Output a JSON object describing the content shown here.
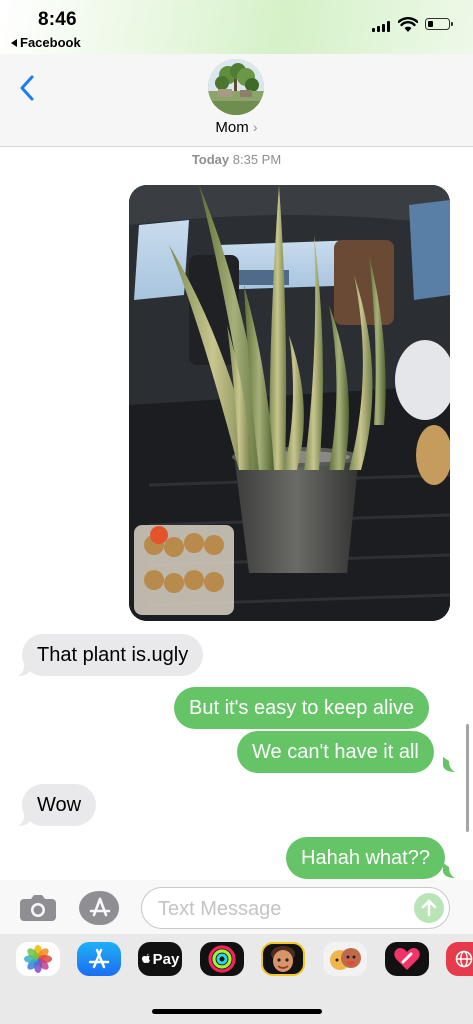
{
  "status_bar": {
    "time": "8:46",
    "back_app": "Facebook"
  },
  "header": {
    "contact_name": "Mom",
    "chevron": "›"
  },
  "conversation": {
    "timestamp_day": "Today",
    "timestamp_time": "8:35 PM",
    "messages": [
      {
        "from": "me",
        "type": "image",
        "description": "photo"
      },
      {
        "from": "them",
        "text": "That plant is.ugly"
      },
      {
        "from": "me",
        "text": "But it's easy to keep alive"
      },
      {
        "from": "me",
        "text": "We can't have it all"
      },
      {
        "from": "them",
        "text": "Wow"
      },
      {
        "from": "me",
        "text": "Hahah what??"
      }
    ]
  },
  "input": {
    "placeholder": "Text Message",
    "value": ""
  },
  "app_drawer": {
    "apple_pay_label": "Pay",
    "apps": [
      "photos-icon",
      "app-store-icon",
      "apple-pay-icon",
      "activity-icon",
      "memoji-icon",
      "animoji-icon",
      "digital-touch-icon",
      "web-icon"
    ]
  },
  "colors": {
    "sms_bubble": "#65c466",
    "incoming_bubble": "#e9e9eb",
    "ios_blue": "#1a7cf5",
    "timestamp_gray": "#8e8e93"
  }
}
